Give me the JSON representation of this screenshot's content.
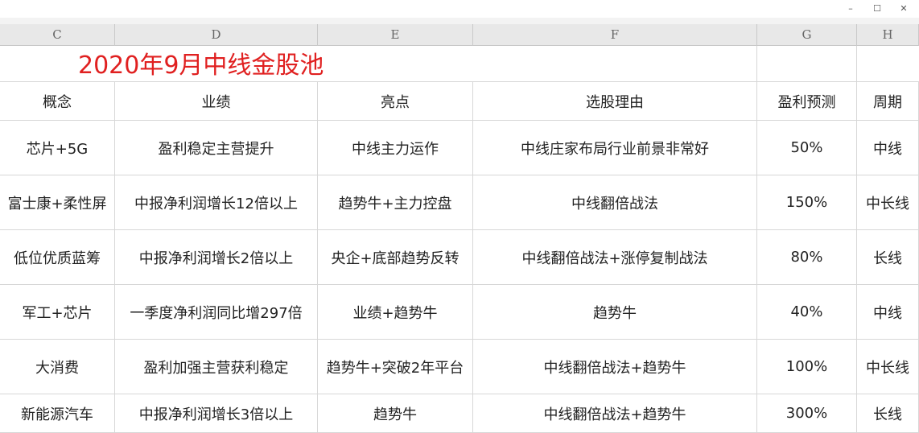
{
  "window": {
    "controls": {
      "minimize": "–",
      "maximize": "☐",
      "close": "✕"
    }
  },
  "columns": [
    "C",
    "D",
    "E",
    "F",
    "G",
    "H"
  ],
  "sheet_title": "2020年9月中线金股池",
  "colors": {
    "title": "#e02020",
    "header_bg": "#e8e8e8",
    "grid": "#d7d7d7"
  },
  "headers": [
    "概念",
    "业绩",
    "亮点",
    "选股理由",
    "盈利预测",
    "周期"
  ],
  "rows": [
    [
      "芯片+5G",
      "盈利稳定主营提升",
      "中线主力运作",
      "中线庄家布局行业前景非常好",
      "50%",
      "中线"
    ],
    [
      "富士康+柔性屏",
      "中报净利润增长12倍以上",
      "趋势牛+主力控盘",
      "中线翻倍战法",
      "150%",
      "中长线"
    ],
    [
      "低位优质蓝筹",
      "中报净利润增长2倍以上",
      "央企+底部趋势反转",
      "中线翻倍战法+涨停复制战法",
      "80%",
      "长线"
    ],
    [
      "军工+芯片",
      "一季度净利润同比增297倍",
      "业绩+趋势牛",
      "趋势牛",
      "40%",
      "中线"
    ],
    [
      "大消费",
      "盈利加强主营获利稳定",
      "趋势牛+突破2年平台",
      "中线翻倍战法+趋势牛",
      "100%",
      "中长线"
    ],
    [
      "新能源汽车",
      "中报净利润增长3倍以上",
      "趋势牛",
      "中线翻倍战法+趋势牛",
      "300%",
      "长线"
    ]
  ]
}
